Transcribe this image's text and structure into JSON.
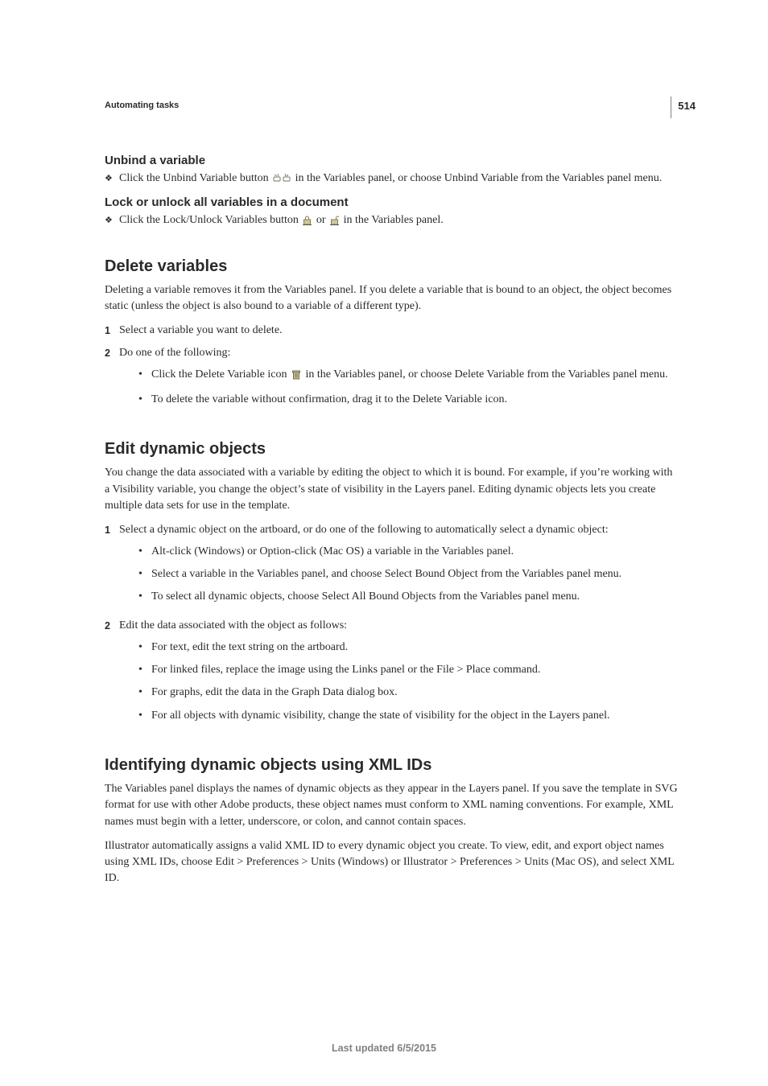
{
  "page_number": "514",
  "breadcrumb": "Automating tasks",
  "sections": {
    "unbind": {
      "heading": "Unbind a variable",
      "item_before": "Click the Unbind Variable button ",
      "item_after": " in the Variables panel, or choose Unbind Variable from the Variables panel menu."
    },
    "lock": {
      "heading": "Lock or unlock all variables in a document",
      "item_before": "Click the Lock/Unlock Variables button ",
      "item_mid": " or ",
      "item_after": " in the Variables panel."
    },
    "delete": {
      "heading": "Delete variables",
      "intro": "Deleting a variable removes it from the Variables panel. If you delete a variable that is bound to an object, the object becomes static (unless the object is also bound to a variable of a different type).",
      "step1": "Select a variable you want to delete.",
      "step2": "Do one of the following:",
      "sub_a_before": "Click the Delete Variable icon ",
      "sub_a_after": " in the Variables panel, or choose Delete Variable from the Variables panel menu.",
      "sub_b": "To delete the variable without confirmation, drag it to the Delete Variable icon."
    },
    "edit": {
      "heading": "Edit dynamic objects",
      "intro": "You change the data associated with a variable by editing the object to which it is bound. For example, if you’re working with a Visibility variable, you change the object’s state of visibility in the Layers panel. Editing dynamic objects lets you create multiple data sets for use in the template.",
      "step1": "Select a dynamic object on the artboard, or do one of the following to automatically select a dynamic object:",
      "s1_a": "Alt-click (Windows) or Option-click (Mac OS) a variable in the Variables panel.",
      "s1_b": "Select a variable in the Variables panel, and choose Select Bound Object from the Variables panel menu.",
      "s1_c": "To select all dynamic objects, choose Select All Bound Objects from the Variables panel menu.",
      "step2": "Edit the data associated with the object as follows:",
      "s2_a": "For text, edit the text string on the artboard.",
      "s2_b": "For linked files, replace the image using the Links panel or the File > Place command.",
      "s2_c": "For graphs, edit the data in the Graph Data dialog box.",
      "s2_d": "For all objects with dynamic visibility, change the state of visibility for the object in the Layers panel."
    },
    "xml": {
      "heading": "Identifying dynamic objects using XML IDs",
      "p1": "The Variables panel displays the names of dynamic objects as they appear in the Layers panel. If you save the template in SVG format for use with other Adobe products, these object names must conform to XML naming conventions. For example, XML names must begin with a letter, underscore, or colon, and cannot contain spaces.",
      "p2": "Illustrator automatically assigns a valid XML ID to every dynamic object you create. To view, edit, and export object names using XML IDs, choose Edit > Preferences > Units (Windows) or Illustrator > Preferences > Units (Mac OS), and select XML ID."
    }
  },
  "footer": "Last updated 6/5/2015"
}
